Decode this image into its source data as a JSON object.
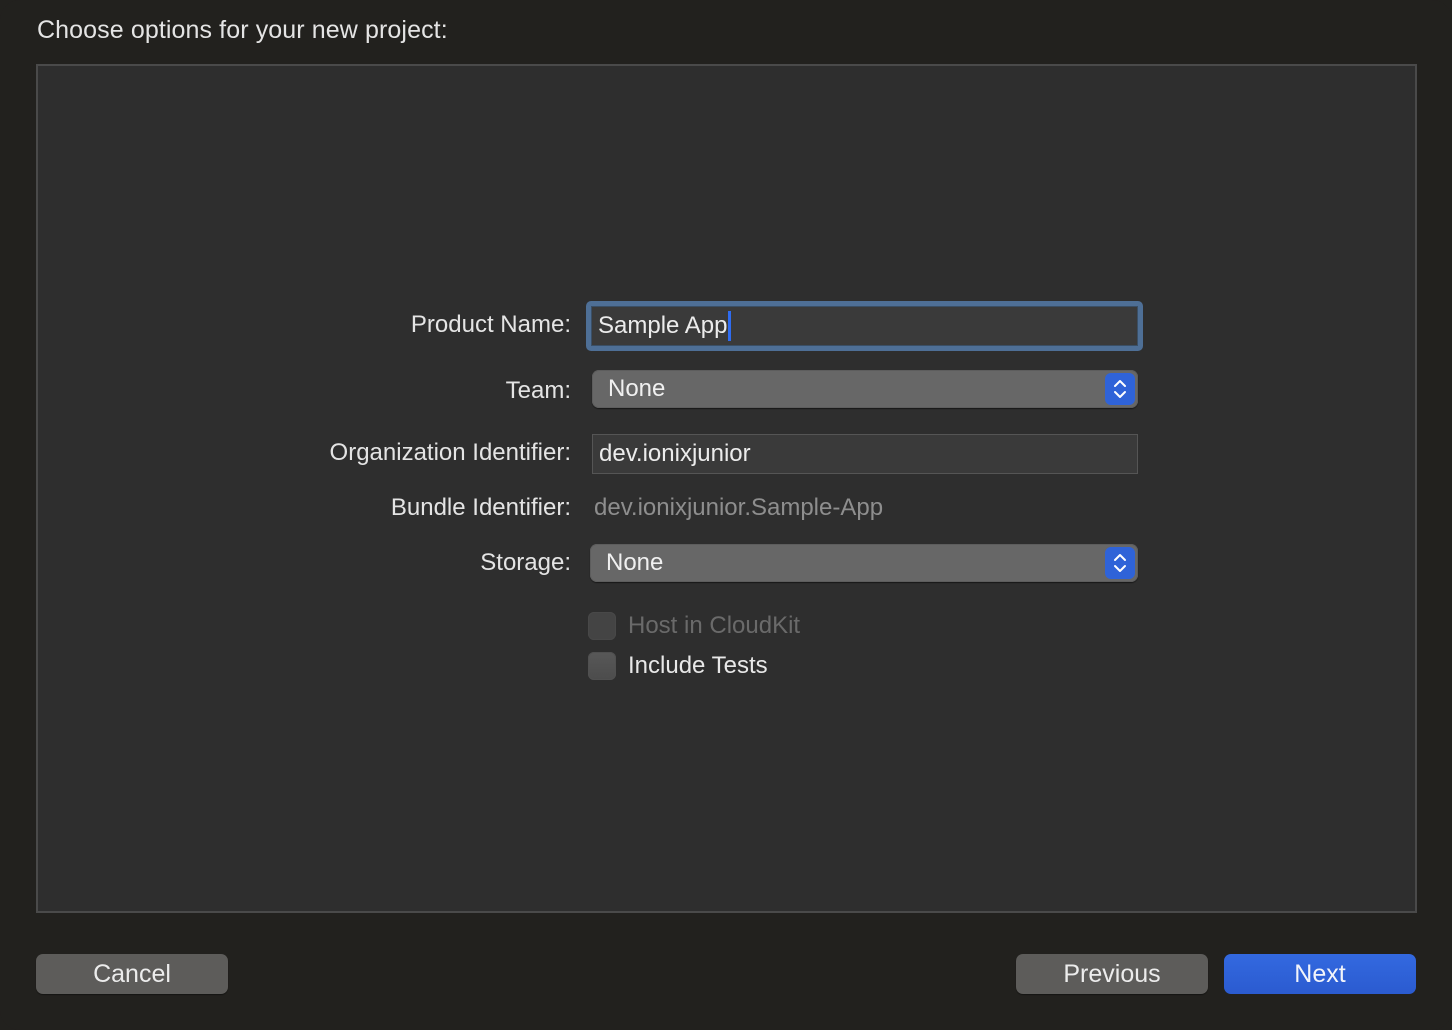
{
  "header": {
    "title": "Choose options for your new project:"
  },
  "form": {
    "product_name": {
      "label": "Product Name:",
      "value": "Sample App",
      "focused": true
    },
    "team": {
      "label": "Team:",
      "selected": "None",
      "icon": "up-down-chevron-icon"
    },
    "organization_identifier": {
      "label": "Organization Identifier:",
      "value": "dev.ionixjunior"
    },
    "bundle_identifier": {
      "label": "Bundle Identifier:",
      "value": "dev.ionixjunior.Sample-App"
    },
    "storage": {
      "label": "Storage:",
      "selected": "None",
      "icon": "up-down-chevron-icon"
    },
    "host_in_cloudkit": {
      "label": "Host in CloudKit",
      "checked": false,
      "enabled": false
    },
    "include_tests": {
      "label": "Include Tests",
      "checked": false,
      "enabled": true
    }
  },
  "footer": {
    "cancel_label": "Cancel",
    "previous_label": "Previous",
    "next_label": "Next"
  },
  "colors": {
    "accent": "#2f63d8",
    "focus_ring": "#4e6f96",
    "background": "#22211e",
    "panel": "#2e2e2e"
  }
}
